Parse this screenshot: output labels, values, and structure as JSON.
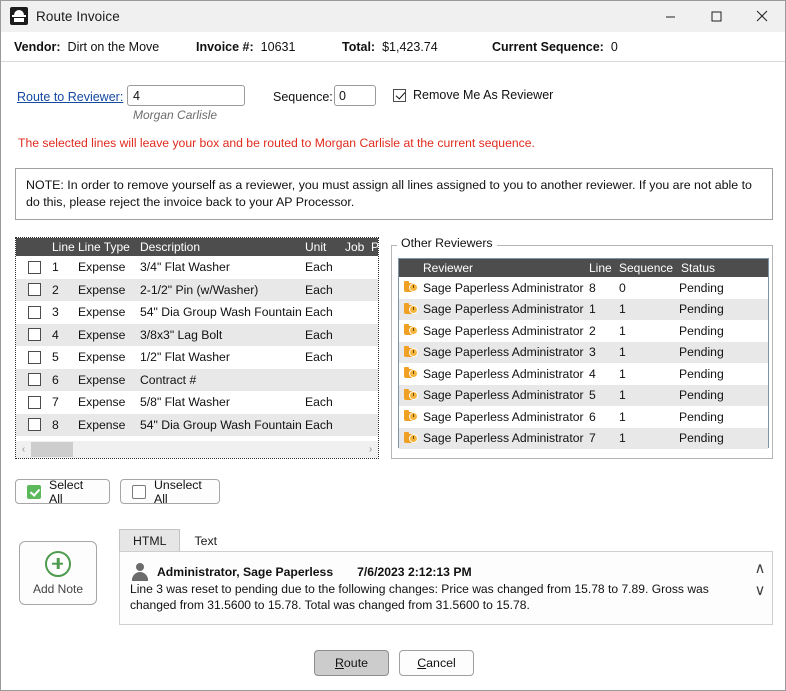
{
  "window": {
    "title": "Route Invoice",
    "icon": "app-icon",
    "minimize": "minimize-icon",
    "maximize": "maximize-icon",
    "close": "close-icon"
  },
  "info": {
    "vendor_label": "Vendor:",
    "vendor_value": "Dirt on the Move",
    "invoice_label": "Invoice #:",
    "invoice_value": "10631",
    "total_label": "Total:",
    "total_value": "$1,423.74",
    "sequence_label": "Current Sequence:",
    "sequence_value": "0"
  },
  "route": {
    "link_label": "Route to Reviewer:",
    "reviewer_value": "4",
    "reviewer_placeholder": "",
    "reviewer_name": "Morgan Carlisle",
    "sequence_label": "Sequence:",
    "sequence_value": "0",
    "sequence_placeholder": "",
    "remove_me_label": "Remove Me As Reviewer",
    "remove_me_checked": true,
    "warning": "The selected lines will leave your box and be routed to Morgan Carlisle at the current sequence.",
    "warning_color": "#e02b1d",
    "note": "NOTE: In order to remove yourself as a reviewer, you must assign all lines assigned to you to another reviewer. If you are not able to do this, please reject the invoice back to your AP Processor."
  },
  "lines_grid": {
    "columns": [
      "Line",
      "Line Type",
      "Description",
      "Unit",
      "Job",
      "Phase"
    ],
    "rows": [
      {
        "checked": false,
        "line": "1",
        "type": "Expense",
        "description": "3/4\" Flat Washer",
        "unit": "Each",
        "job": "",
        "phase": ""
      },
      {
        "checked": false,
        "line": "2",
        "type": "Expense",
        "description": "2-1/2\" Pin (w/Washer)",
        "unit": "Each",
        "job": "",
        "phase": ""
      },
      {
        "checked": false,
        "line": "3",
        "type": "Expense",
        "description": "54\" Dia Group Wash Fountain",
        "unit": "Each",
        "job": "",
        "phase": ""
      },
      {
        "checked": false,
        "line": "4",
        "type": "Expense",
        "description": "3/8x3\" Lag Bolt",
        "unit": "Each",
        "job": "",
        "phase": ""
      },
      {
        "checked": false,
        "line": "5",
        "type": "Expense",
        "description": "1/2\" Flat Washer",
        "unit": "Each",
        "job": "",
        "phase": ""
      },
      {
        "checked": false,
        "line": "6",
        "type": "Expense",
        "description": "Contract #",
        "unit": "",
        "job": "",
        "phase": ""
      },
      {
        "checked": false,
        "line": "7",
        "type": "Expense",
        "description": "5/8\" Flat Washer",
        "unit": "Each",
        "job": "",
        "phase": ""
      },
      {
        "checked": false,
        "line": "8",
        "type": "Expense",
        "description": "54\" Dia Group Wash Fountain",
        "unit": "Each",
        "job": "",
        "phase": ""
      }
    ]
  },
  "other_reviewers": {
    "legend": "Other Reviewers",
    "columns": [
      "Reviewer",
      "Line",
      "Sequence",
      "Status"
    ],
    "rows": [
      {
        "icon": "pending-clock-icon",
        "reviewer": "Sage Paperless Administrator",
        "line": "8",
        "sequence": "0",
        "status": "Pending"
      },
      {
        "icon": "pending-clock-icon",
        "reviewer": "Sage Paperless Administrator",
        "line": "1",
        "sequence": "1",
        "status": "Pending"
      },
      {
        "icon": "pending-clock-icon",
        "reviewer": "Sage Paperless Administrator",
        "line": "2",
        "sequence": "1",
        "status": "Pending"
      },
      {
        "icon": "pending-clock-icon",
        "reviewer": "Sage Paperless Administrator",
        "line": "3",
        "sequence": "1",
        "status": "Pending"
      },
      {
        "icon": "pending-clock-icon",
        "reviewer": "Sage Paperless Administrator",
        "line": "4",
        "sequence": "1",
        "status": "Pending"
      },
      {
        "icon": "pending-clock-icon",
        "reviewer": "Sage Paperless Administrator",
        "line": "5",
        "sequence": "1",
        "status": "Pending"
      },
      {
        "icon": "pending-clock-icon",
        "reviewer": "Sage Paperless Administrator",
        "line": "6",
        "sequence": "1",
        "status": "Pending"
      },
      {
        "icon": "pending-clock-icon",
        "reviewer": "Sage Paperless Administrator",
        "line": "7",
        "sequence": "1",
        "status": "Pending"
      }
    ]
  },
  "selection": {
    "select_all": "Select All",
    "unselect_all": "Unselect All"
  },
  "notes": {
    "add_note": "Add Note",
    "tabs": [
      {
        "label": "HTML",
        "active": true
      },
      {
        "label": "Text",
        "active": false
      }
    ],
    "entry": {
      "author": "Administrator, Sage Paperless",
      "timestamp": "7/6/2023 2:12:13 PM",
      "body": "Line 3 was reset to pending due to the following changes: Price was changed from 15.78 to 7.89. Gross was changed from 31.5600 to 15.78. Total was changed from 31.5600 to 15.78."
    },
    "scroll_up": "∧",
    "scroll_down": "∨"
  },
  "footer": {
    "route": "Route",
    "route_accel": "R",
    "route_rest": "oute",
    "cancel": "Cancel",
    "cancel_accel": "C",
    "cancel_rest": "ancel"
  },
  "colors": {
    "link": "#1449a0",
    "warning": "#e02b1d",
    "header_bar": "#4d4d4d",
    "pending_icon": "#f0a023",
    "select_green": "#5cb85c"
  }
}
